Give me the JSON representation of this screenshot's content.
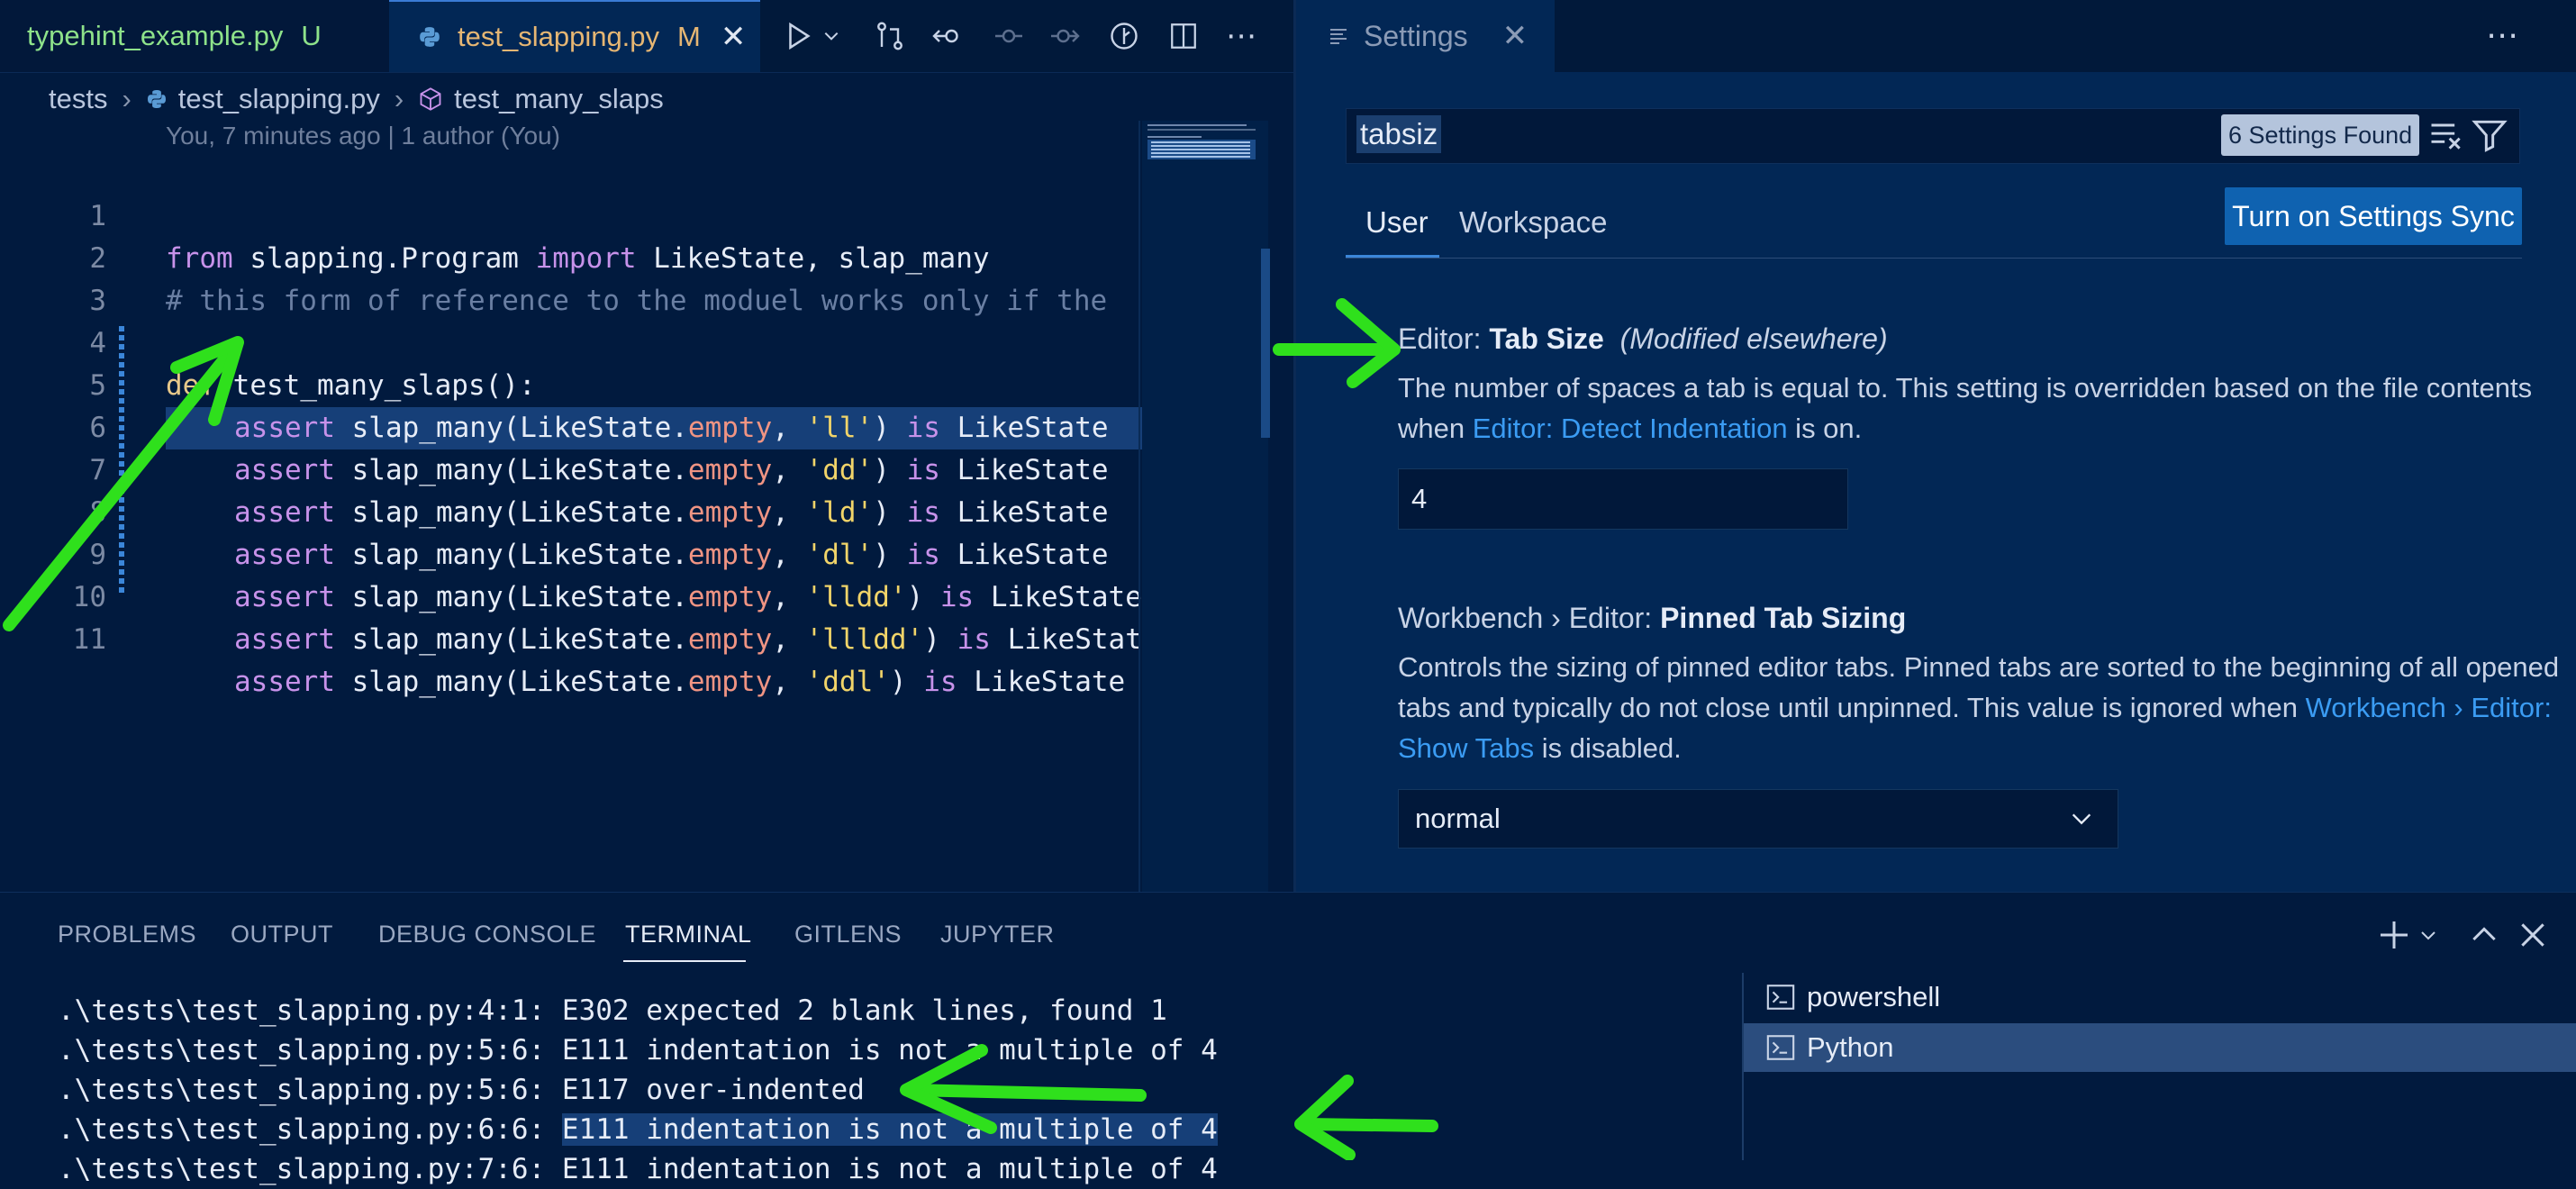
{
  "left_editor": {
    "tabs": [
      {
        "label": "typehint_example.py",
        "badge": "U"
      },
      {
        "label": "test_slapping.py",
        "badge": "M"
      }
    ],
    "breadcrumb": [
      "tests",
      "test_slapping.py",
      "test_many_slaps"
    ],
    "blame": "You, 7 minutes ago | 1 author (You)",
    "line_numbers": [
      "1",
      "2",
      "3",
      "4",
      "5",
      "6",
      "7",
      "8",
      "9",
      "10",
      "11"
    ],
    "code": {
      "l1_from": "from",
      "l1_mod": " slapping.Program ",
      "l1_import": "import",
      "l1_rest": " LikeState, slap_many",
      "l2": "# this form of reference to the moduel works only if the",
      "l4_def": "def",
      "l4_rest": " test_many_slaps():",
      "assert_kw": "assert",
      "call": " slap_many(LikeState.",
      "empty": "empty",
      "comma": ", ",
      "strings": [
        "'ll'",
        "'dd'",
        "'ld'",
        "'dl'",
        "'lldd'",
        "'llldd'",
        "'ddl'"
      ],
      "close": ")",
      "is_kw": " is",
      "tail": " LikeState"
    }
  },
  "settings": {
    "tab_label": "Settings",
    "search_value": "tabsiz",
    "results_badge": "6 Settings Found",
    "scopes": [
      "User",
      "Workspace"
    ],
    "sync_button": "Turn on Settings Sync",
    "tab_size": {
      "category": "Editor: ",
      "name": "Tab Size",
      "modified": "(Modified elsewhere)",
      "desc_part1": "The number of spaces a tab is equal to. This setting is overridden based on the file contents when ",
      "desc_link": "Editor: Detect Indentation",
      "desc_part2": " is on.",
      "value": "4"
    },
    "pinned_tab_sizing": {
      "category": "Workbench › Editor: ",
      "name": "Pinned Tab Sizing",
      "desc_part1": "Controls the sizing of pinned editor tabs. Pinned tabs are sorted to the beginning of all opened tabs and typically do not close until unpinned. This value is ignored when ",
      "desc_link": "Workbench › Editor: Show Tabs",
      "desc_part2": " is disabled.",
      "value": "normal"
    }
  },
  "panel": {
    "tabs": [
      "PROBLEMS",
      "OUTPUT",
      "DEBUG CONSOLE",
      "TERMINAL",
      "GITLENS",
      "JUPYTER"
    ],
    "active_tab": "TERMINAL",
    "terminal_lines": [
      ".\\tests\\test_slapping.py:4:1: E302 expected 2 blank lines, found 1",
      ".\\tests\\test_slapping.py:5:6: E111 indentation is not a multiple of 4",
      ".\\tests\\test_slapping.py:5:6: E117 over-indented",
      ".\\tests\\test_slapping.py:6:6: ",
      "E111 indentation is not a multiple of 4",
      ".\\tests\\test_slapping.py:7:6: E111 indentation is not a multiple of 4"
    ],
    "terminals": [
      "powershell",
      "Python"
    ]
  },
  "colors": {
    "background": "#011a3e",
    "accent": "#3b86d9",
    "annotation_arrow": "#2fe01c"
  }
}
